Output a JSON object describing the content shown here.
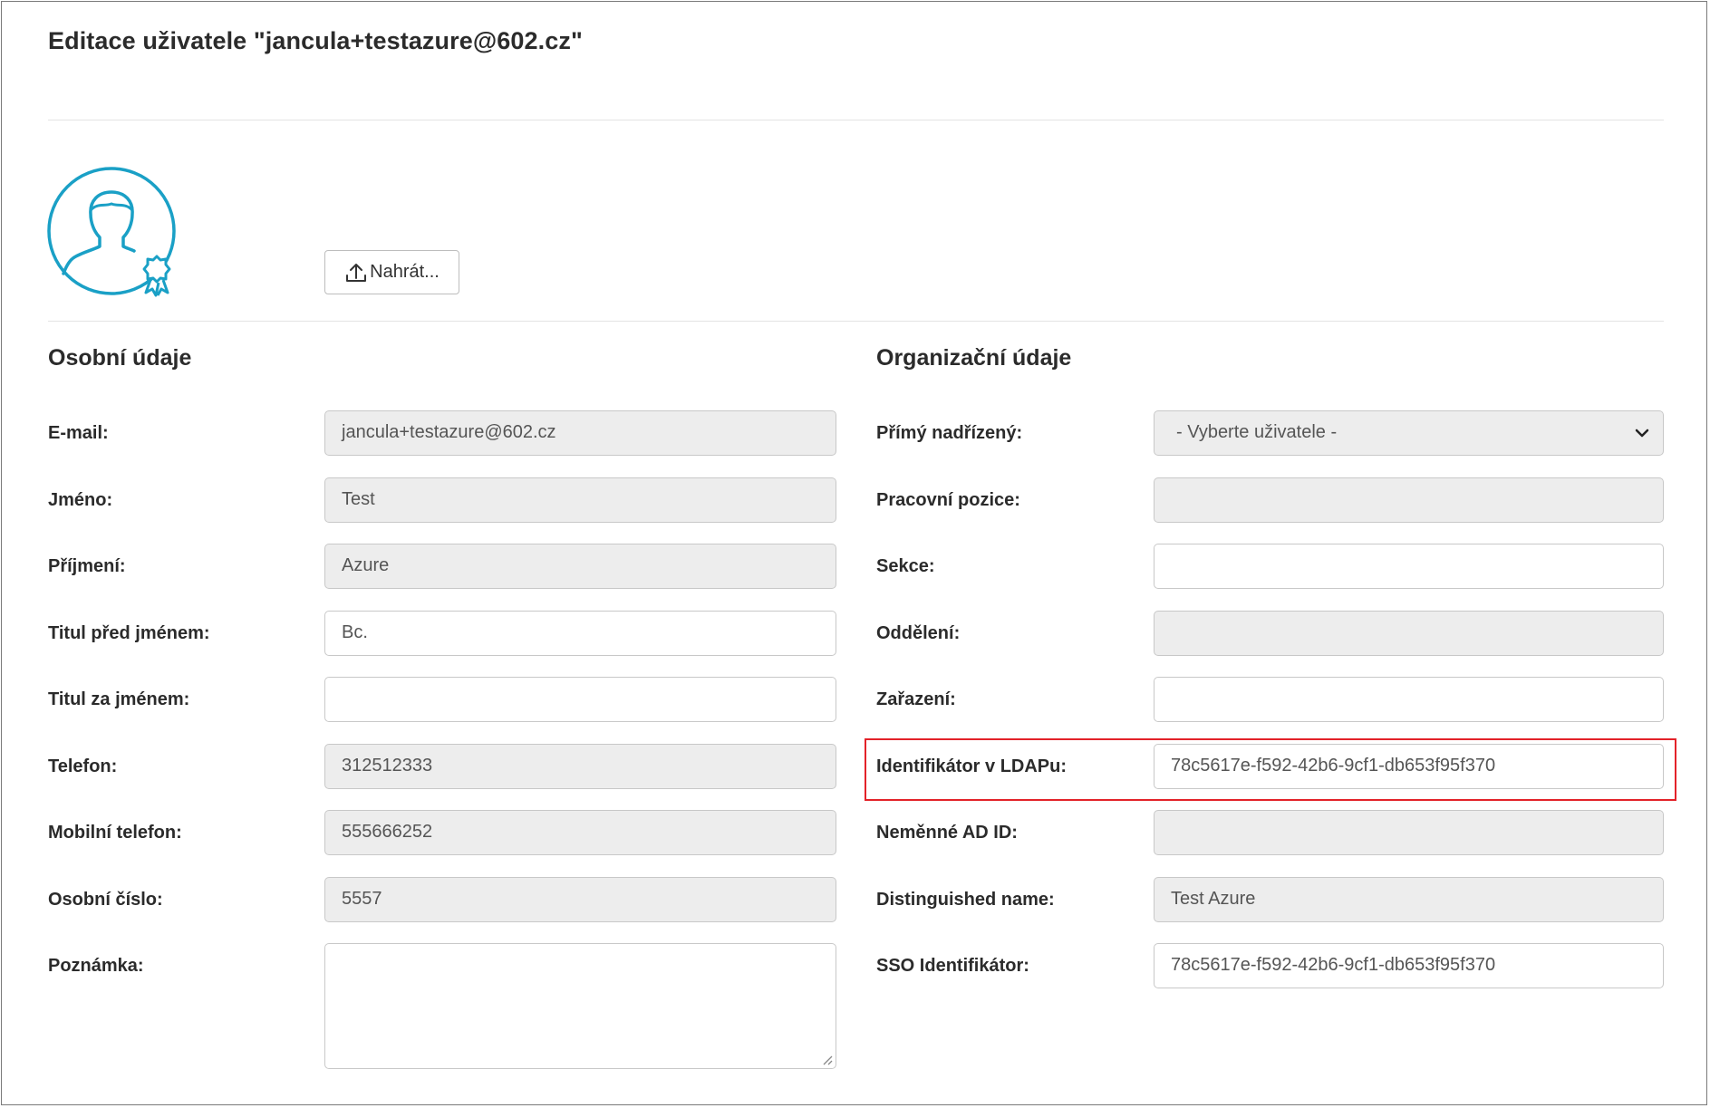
{
  "header": {
    "title": "Editace uživatele \"jancula+testazure@602.cz\""
  },
  "avatar": {
    "icon": "user-certified-avatar-icon",
    "color": "#1aa0c6"
  },
  "upload": {
    "label": "Nahrát...",
    "icon": "upload-icon"
  },
  "personal": {
    "title": "Osobní údaje",
    "fields": {
      "email": {
        "label": "E-mail:",
        "value": "jancula+testazure@602.cz"
      },
      "first_name": {
        "label": "Jméno:",
        "value": "Test"
      },
      "last_name": {
        "label": "Příjmení:",
        "value": "Azure"
      },
      "title_before": {
        "label": "Titul před jménem:",
        "value": "Bc."
      },
      "title_after": {
        "label": "Titul za jménem:",
        "value": ""
      },
      "phone": {
        "label": "Telefon:",
        "value": "312512333"
      },
      "mobile": {
        "label": "Mobilní telefon:",
        "value": "555666252"
      },
      "personal_number": {
        "label": "Osobní číslo:",
        "value": "5557"
      },
      "note": {
        "label": "Poznámka:",
        "value": ""
      }
    }
  },
  "organization": {
    "title": "Organizační údaje",
    "fields": {
      "manager": {
        "label": "Přímý nadřízený:",
        "value": "- Vyberte uživatele -"
      },
      "position": {
        "label": "Pracovní pozice:",
        "value": ""
      },
      "section": {
        "label": "Sekce:",
        "value": ""
      },
      "department": {
        "label": "Oddělení:",
        "value": ""
      },
      "classification": {
        "label": "Zařazení:",
        "value": ""
      },
      "ldap_id": {
        "label": "Identifikátor v LDAPu:",
        "value": "78c5617e-f592-42b6-9cf1-db653f95f370"
      },
      "immutable_ad_id": {
        "label": "Neměnné AD ID:",
        "value": ""
      },
      "distinguished_name": {
        "label": "Distinguished name:",
        "value": "Test Azure"
      },
      "sso_id": {
        "label": "SSO Identifikátor:",
        "value": "78c5617e-f592-42b6-9cf1-db653f95f370"
      }
    }
  },
  "colors": {
    "accent": "#1aa0c6",
    "highlight": "#e32229",
    "disabled_bg": "#ededed"
  }
}
